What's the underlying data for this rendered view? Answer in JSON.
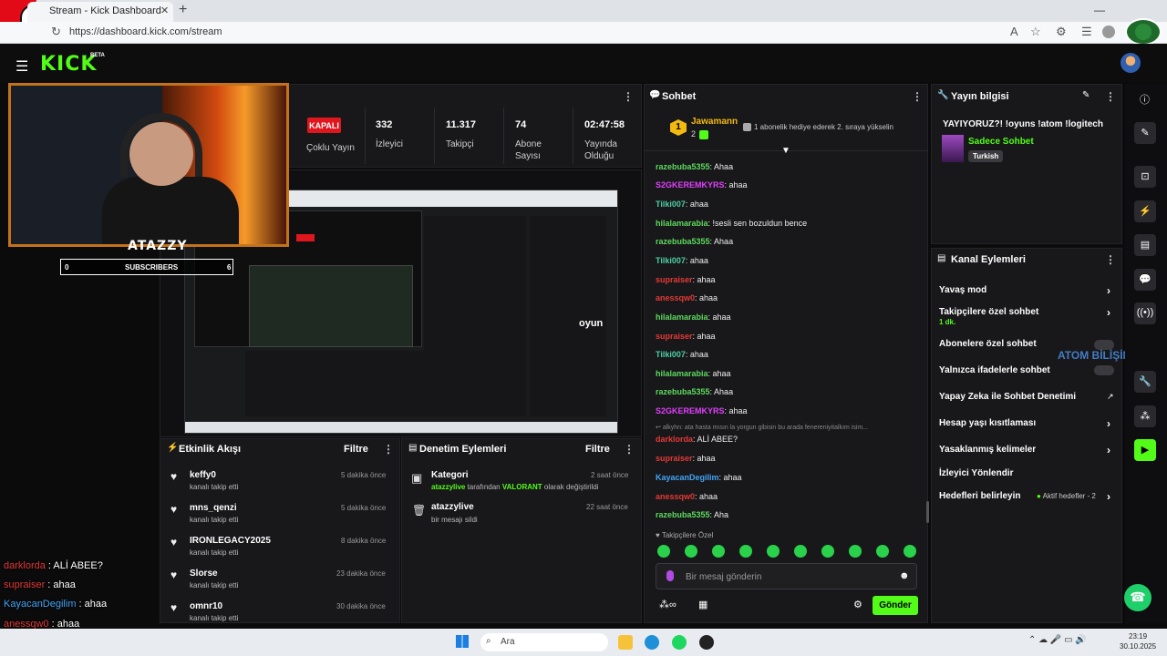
{
  "browser": {
    "tab_title": "Stream - Kick Dashboard",
    "url": "https://dashboard.kick.com/stream"
  },
  "app": {
    "logo": "KICK",
    "beta": "BETA"
  },
  "stream_stats": {
    "status_badge": "KAPALI",
    "status_label": "Çoklu Yayın",
    "viewers_value": "332",
    "viewers_label": "İzleyici",
    "followers_value": "11.317",
    "followers_label": "Takipçi",
    "subscribers_value": "74",
    "subscribers_label": "Abone Sayısı",
    "uptime_value": "02:47:58",
    "uptime_label": "Yayında Olduğu"
  },
  "webcam": {
    "name": "ATAZZY",
    "subs_left": "0",
    "subs_label": "SUBSCRIBERS",
    "subs_right": "6"
  },
  "chat": {
    "title": "Sohbet",
    "pinned_user": "Jawamann",
    "pinned_rank": "1",
    "pinned_count": "2",
    "pinned_text": "1 abonelik hediye ederek 2. sıraya yükselin",
    "messages": [
      {
        "user": "razebuba5355",
        "text": ": Ahaa",
        "color": "#5dd95d"
      },
      {
        "user": "S2GKEREMKYRS",
        "text": ": ahaa",
        "color": "#e040fb"
      },
      {
        "user": "Tilki007",
        "text": ": ahaa",
        "color": "#4dd0a0"
      },
      {
        "user": "hilalamarabia",
        "text": ": !sesli sen bozuldun bence",
        "color": "#5dd95d"
      },
      {
        "user": "razebuba5355",
        "text": ": Ahaa",
        "color": "#5dd95d"
      },
      {
        "user": "Tilki007",
        "text": ": ahaa",
        "color": "#4dd0a0"
      },
      {
        "user": "supraiser",
        "text": ": ahaa",
        "color": "#e53935"
      },
      {
        "user": "anessqw0",
        "text": ": ahaa",
        "color": "#e53935"
      },
      {
        "user": "hilalamarabia",
        "text": ": ahaa",
        "color": "#5dd95d"
      },
      {
        "user": "supraiser",
        "text": ": ahaa",
        "color": "#e53935"
      },
      {
        "user": "Tilki007",
        "text": ": ahaa",
        "color": "#4dd0a0"
      },
      {
        "user": "hilalamarabia",
        "text": ": ahaa",
        "color": "#5dd95d"
      },
      {
        "user": "razebuba5355",
        "text": ": Ahaa",
        "color": "#5dd95d"
      },
      {
        "user": "S2GKEREMKYRS",
        "text": ": ahaa",
        "color": "#e040fb"
      }
    ],
    "reply_preview": "alkyhn: ata hasta mısın la yorgun gibisin bu arada fenereniyitalkım isim...",
    "messages2": [
      {
        "user": "darklorda",
        "text": ": ALİ ABEE?",
        "color": "#e53935"
      },
      {
        "user": "supraiser",
        "text": ": ahaa",
        "color": "#e53935"
      },
      {
        "user": "KayacanDegilim",
        "text": ": ahaa",
        "color": "#42a5f5"
      },
      {
        "user": "anessqw0",
        "text": ": ahaa",
        "color": "#e53935"
      },
      {
        "user": "razebuba5355",
        "text": ": Aha",
        "color": "#5dd95d"
      }
    ],
    "followers_only": "Takipçilere Özel",
    "input_placeholder": "Bir mesaj gönderin",
    "send_label": "Gönder"
  },
  "stream_info": {
    "title": "Yayın bilgisi",
    "stream_title": "YAYIYORUZ?! !oyuns !atom !logitech",
    "category": "Sadece Sohbet",
    "language": "Turkish"
  },
  "channel_actions": {
    "title": "Kanal Eylemleri",
    "items": [
      {
        "label": "Yavaş mod",
        "sub": ""
      },
      {
        "label": "Takipçilere özel sohbet",
        "sub": "1 dk."
      },
      {
        "label": "Abonelere özel sohbet",
        "sub": ""
      },
      {
        "label": "Yalnızca ifadelerle sohbet",
        "sub": ""
      },
      {
        "label": "Yapay Zeka ile Sohbet Denetimi",
        "sub": ""
      },
      {
        "label": "Hesap yaşı kısıtlaması",
        "sub": ""
      },
      {
        "label": "Yasaklanmış kelimeler",
        "sub": ""
      },
      {
        "label": "İzleyici Yönlendir",
        "sub": ""
      },
      {
        "label": "Hedefleri belirleyin",
        "sub": ""
      }
    ],
    "goal_status": "Aktif hedefler - 2",
    "watermark": "ATOM BİLİŞİM"
  },
  "activity_feed": {
    "title": "Etkinlik Akışı",
    "filter": "Filtre",
    "events": [
      {
        "name": "keffy0",
        "action": "kanalı takip etti",
        "time": "5 dakika önce"
      },
      {
        "name": "mns_qenzi",
        "action": "kanalı takip etti",
        "time": "5 dakika önce"
      },
      {
        "name": "IRONLEGACY2025",
        "action": "kanalı takip etti",
        "time": "8 dakika önce"
      },
      {
        "name": "Slorse",
        "action": "kanalı takip etti",
        "time": "23 dakika önce"
      },
      {
        "name": "omnr10",
        "action": "kanalı takip etti",
        "time": "30 dakika önce"
      }
    ]
  },
  "mod_actions": {
    "title": "Denetim Eylemleri",
    "filter": "Filtre",
    "items": [
      {
        "title": "Kategori",
        "user": "atazzylive",
        "mid": " tarafından ",
        "highlight": "VALORANT",
        "tail": " olarak değiştirildi",
        "time": "2 saat önce"
      },
      {
        "title": "atazzylive",
        "desc": "bir mesajı sildi",
        "time": "22 saat önce"
      }
    ]
  },
  "overlay_chat": [
    {
      "user": "darklorda",
      "text": " : ALİ ABEE?",
      "color": "#e53935"
    },
    {
      "user": "supraiser",
      "text": " : ahaa",
      "color": "#e53935"
    },
    {
      "user": "KayacanDegilim",
      "text": " : ahaa",
      "color": "#42a5f5"
    },
    {
      "user": "anessqw0",
      "text": " : ahaa",
      "color": "#e53935"
    },
    {
      "user": "razebuba5355",
      "text": " : Aha",
      "color": "#5dd95d"
    }
  ],
  "preview_brand": "oyun",
  "taskbar": {
    "search": "Ara",
    "time": "23:19",
    "date": "30.10.2025"
  },
  "colors": {
    "accent": "#53fc18",
    "panel": "#18181b",
    "live": "#e0161e"
  }
}
